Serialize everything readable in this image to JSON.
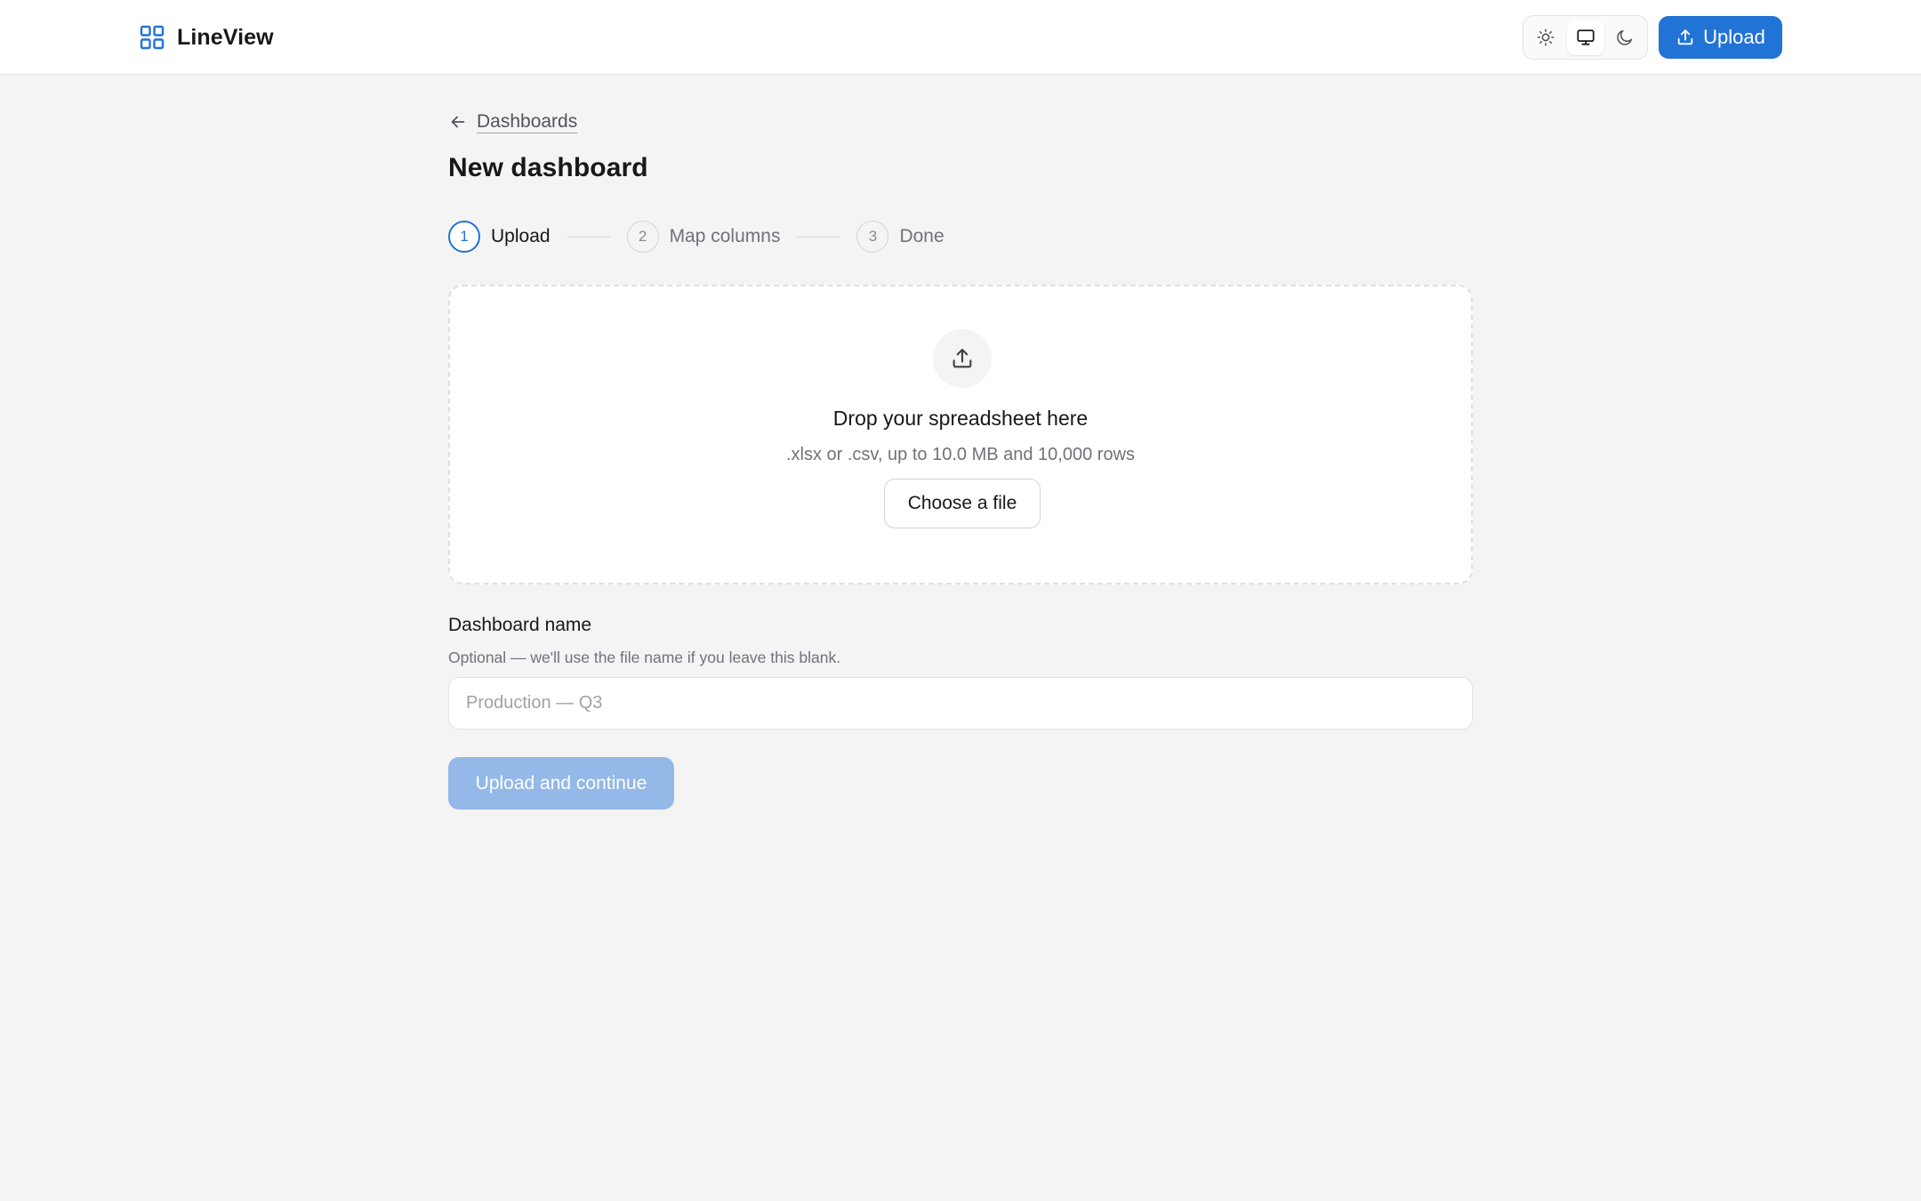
{
  "app": {
    "name": "LineView",
    "logo_icon": "grid-icon",
    "accent_color": "#2173d6"
  },
  "header": {
    "theme_options": [
      {
        "name": "light",
        "icon": "sun-icon",
        "active": false
      },
      {
        "name": "system",
        "icon": "monitor-icon",
        "active": true
      },
      {
        "name": "dark",
        "icon": "moon-icon",
        "active": false
      }
    ],
    "upload_button": {
      "label": "Upload",
      "icon": "upload-icon"
    }
  },
  "breadcrumb": {
    "back_icon": "arrow-left-icon",
    "label": "Dashboards"
  },
  "page": {
    "title": "New dashboard"
  },
  "stepper": {
    "steps": [
      {
        "number": "1",
        "label": "Upload",
        "active": true
      },
      {
        "number": "2",
        "label": "Map columns",
        "active": false
      },
      {
        "number": "3",
        "label": "Done",
        "active": false
      }
    ]
  },
  "dropzone": {
    "icon": "upload-icon",
    "title": "Drop your spreadsheet here",
    "subtitle": ".xlsx or .csv, up to 10.0 MB and 10,000 rows",
    "choose_label": "Choose a file"
  },
  "form": {
    "name_label": "Dashboard name",
    "name_help": "Optional — we'll use the file name if you leave this blank.",
    "name_value": "",
    "name_placeholder": "Production — Q3",
    "submit_label": "Upload and continue",
    "submit_enabled": false
  }
}
